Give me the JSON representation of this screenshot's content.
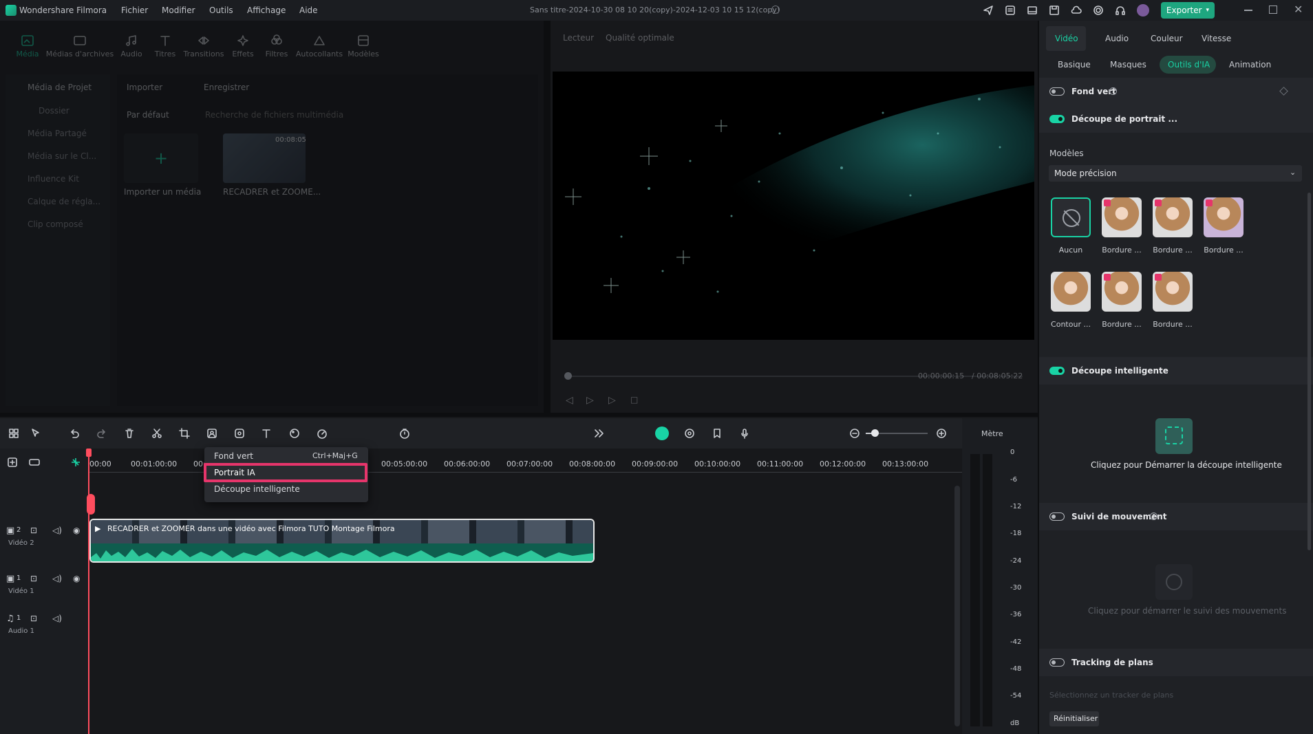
{
  "app": {
    "name": "Wondershare Filmora",
    "menus": [
      "Fichier",
      "Modifier",
      "Outils",
      "Affichage",
      "Aide"
    ],
    "project_title": "Sans titre-2024-10-30 08 10 20(copy)-2024-12-03 10 15 12(copy)",
    "export_label": "Exporter"
  },
  "media": {
    "tabs": [
      "Média",
      "Médias d'archives",
      "Audio",
      "Titres",
      "Transitions",
      "Effets",
      "Filtres",
      "Autocollants",
      "Modèles"
    ],
    "sidebar": [
      "Média de Projet",
      "Dossier",
      "Média Partagé",
      "Média sur le Cl...",
      "Influence Kit",
      "Calque de régla...",
      "Clip composé"
    ],
    "import_label": "Importer",
    "record_label": "Enregistrer",
    "sort_label": "Par défaut",
    "search_placeholder": "Recherche de fichiers multimédia",
    "import_tile_label": "Importer un média",
    "clip_tile_label": "RECADRER et ZOOME...",
    "clip_duration": "00:08:05"
  },
  "preview": {
    "player_label": "Lecteur",
    "quality_label": "Qualité optimale",
    "current_time": "00:00:00:15",
    "total_time": "/ 00:08:05:22"
  },
  "context_menu": {
    "items": [
      {
        "label": "Fond vert",
        "shortcut": "Ctrl+Maj+G"
      },
      {
        "label": "Portrait IA",
        "shortcut": ""
      },
      {
        "label": "Découpe intelligente",
        "shortcut": ""
      }
    ]
  },
  "timeline": {
    "ticks": [
      "00:00",
      "00:01:00:00",
      "00:0",
      "00:05:00:00",
      "00:06:00:00",
      "00:07:00:00",
      "00:08:00:00",
      "00:09:00:00",
      "00:10:00:00",
      "00:11:00:00",
      "00:12:00:00",
      "00:13:00:00"
    ],
    "clip_title": "RECADRER et ZOOMER dans une vidéo avec Filmora  TUTO Montage Filmora",
    "tracks": [
      {
        "num": "2",
        "name": "Vidéo 2"
      },
      {
        "num": "1",
        "name": "Vidéo 1"
      },
      {
        "num": "1",
        "name": "Audio 1"
      }
    ],
    "meter_label": "Mètre",
    "meter_scale": [
      "0",
      "-6",
      "-12",
      "-18",
      "-24",
      "-30",
      "-36",
      "-42",
      "-48",
      "-54",
      "dB"
    ]
  },
  "right_panel": {
    "tabs": [
      "Vidéo",
      "Audio",
      "Couleur",
      "Vitesse"
    ],
    "subtabs": [
      "Basique",
      "Masques",
      "Outils d'IA",
      "Animation"
    ],
    "active_subtab": "Outils d'IA",
    "fond_vert": {
      "label": "Fond vert",
      "on": false
    },
    "decoupe_portrait": {
      "label": "Découpe de portrait ...",
      "on": true
    },
    "models_label": "Modèles",
    "model_select": "Mode précision",
    "templates": [
      "Aucun",
      "Bordure ...",
      "Bordure ...",
      "Bordure ...",
      "Contour ...",
      "Bordure ...",
      "Bordure ..."
    ],
    "decoupe_intelligente": {
      "label": "Découpe intelligente",
      "on": true,
      "action": "Cliquez pour Démarrer la découpe intelligente"
    },
    "suivi_mouvement": {
      "label": "Suivi de mouvement",
      "on": false,
      "action": "Cliquez pour démarrer le suivi des mouvements"
    },
    "tracking_plans": {
      "label": "Tracking de plans",
      "on": false,
      "hint": "Sélectionnez un tracker de plans"
    },
    "reset_label": "Réinitialiser"
  },
  "colors": {
    "accent": "#19d3a5",
    "highlight": "#e6356b",
    "playhead": "#ff4d5e",
    "export": "#1ea67f"
  }
}
